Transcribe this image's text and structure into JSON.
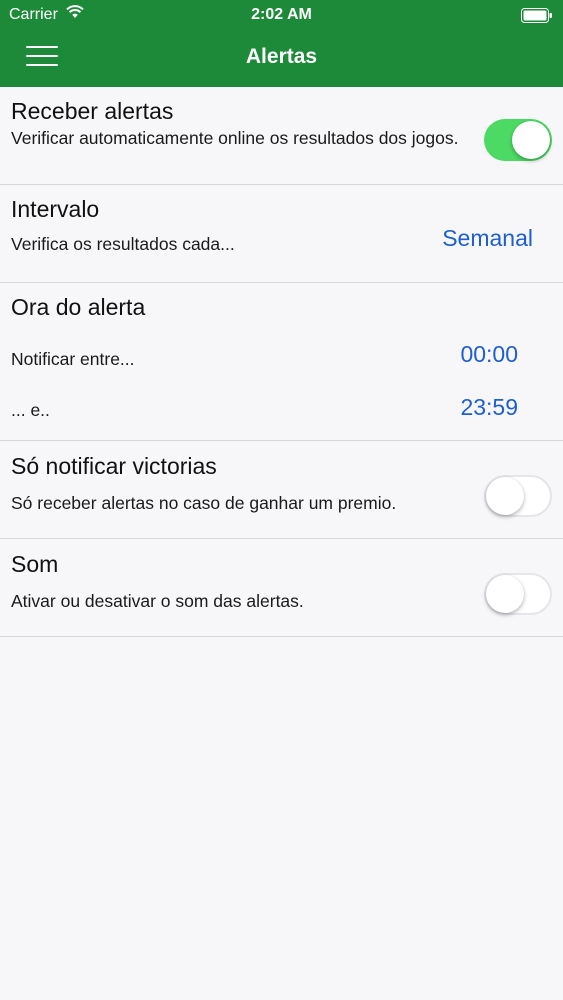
{
  "status_bar": {
    "carrier": "Carrier",
    "time": "2:02 AM",
    "wifi_icon": "wifi-icon",
    "battery_icon": "battery-icon"
  },
  "nav": {
    "title": "Alertas",
    "menu_icon": "hamburger-menu-icon"
  },
  "colors": {
    "accent_green": "#1d8a3a",
    "toggle_on": "#4cd964",
    "link_blue": "#1d5fd0"
  },
  "sections": {
    "receive_alerts": {
      "title": "Receber alertas",
      "description": "Verificar automaticamente online os resultados dos jogos.",
      "enabled": true
    },
    "interval": {
      "title": "Intervalo",
      "description": "Verifica os resultados cada...",
      "value": "Semanal"
    },
    "alert_time": {
      "title": "Ora do alerta",
      "from_label": "Notificar entre...",
      "from_value": "00:00",
      "to_label": "... e..",
      "to_value": "23:59"
    },
    "only_wins": {
      "title": "Só notificar victorias",
      "description": "Só receber alertas no caso de ganhar um premio.",
      "enabled": false
    },
    "sound": {
      "title": "Som",
      "description": "Ativar ou desativar o som das alertas.",
      "enabled": false
    }
  }
}
